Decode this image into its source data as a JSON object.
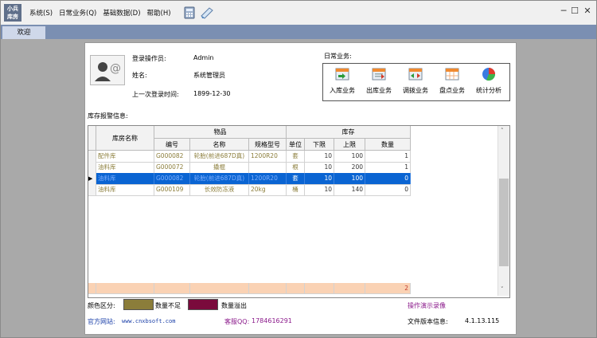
{
  "app": {
    "logo_text": "小兵\n库房",
    "logo_line1": "小兵",
    "logo_line2": "库房"
  },
  "menu": [
    {
      "label": "系统(S)"
    },
    {
      "label": "日常业务(Q)"
    },
    {
      "label": "基础数据(D)"
    },
    {
      "label": "帮助(H)"
    }
  ],
  "tabs": [
    {
      "label": "欢迎"
    }
  ],
  "login": {
    "operator_label": "登录操作员:",
    "operator_value": "Admin",
    "name_label": "姓名:",
    "name_value": "系统管理员",
    "last_login_label": "上一次登录时间:",
    "last_login_value": "1899-12-30"
  },
  "business": {
    "title": "日常业务:",
    "buttons": [
      {
        "label": "入库业务",
        "icon": "inbound-icon"
      },
      {
        "label": "出库业务",
        "icon": "outbound-icon"
      },
      {
        "label": "调拨业务",
        "icon": "transfer-icon"
      },
      {
        "label": "盘点业务",
        "icon": "inventory-check-icon"
      },
      {
        "label": "统计分析",
        "icon": "pie-chart-icon"
      }
    ]
  },
  "stock_alert": {
    "title": "库存报警信息:",
    "headers": {
      "warehouse": "库房名称",
      "goods": "物品",
      "stock": "库存",
      "code": "编号",
      "name": "名称",
      "spec": "规格型号",
      "unit": "单位",
      "lower": "下限",
      "upper": "上限",
      "qty": "数量"
    },
    "rows": [
      {
        "warehouse": "配件库",
        "code": "G000082",
        "name": "轮胎(前进687D真)",
        "spec": "1200R20",
        "unit": "套",
        "lower": "10",
        "upper": "100",
        "qty": "1",
        "status": "insufficient"
      },
      {
        "warehouse": "油料库",
        "code": "G000072",
        "name": "撬棍",
        "spec": "",
        "unit": "根",
        "lower": "10",
        "upper": "200",
        "qty": "1",
        "status": "insufficient"
      },
      {
        "warehouse": "油料库",
        "code": "G000082",
        "name": "轮胎(前进687D真)",
        "spec": "1200R20",
        "unit": "套",
        "lower": "10",
        "upper": "100",
        "qty": "0",
        "status": "selected"
      },
      {
        "warehouse": "油料库",
        "code": "G000109",
        "name": "长效防冻液",
        "spec": "20kg",
        "unit": "桶",
        "lower": "10",
        "upper": "140",
        "qty": "0",
        "status": "insufficient"
      }
    ],
    "total_qty": "2"
  },
  "legend": {
    "label": "颜色区分:",
    "insufficient_label": "数量不足",
    "overflow_label": "数量溢出",
    "insufficient_color": "#8b7d3a",
    "overflow_color": "#7a0a3c"
  },
  "links": {
    "demo_video": "操作演示录像",
    "website_label": "官方网站:",
    "website_value": "www.cnxbsoft.com",
    "qq_label": "客服QQ:",
    "qq_value": "1784616291",
    "version_label": "文件版本信息:",
    "version_value": "4.1.13.115"
  },
  "colors": {
    "tabbar": "#7b8fb2",
    "selected_row": "#0a64d2",
    "total_row": "#fad2b4",
    "insufficient_text": "#8b7d3a"
  }
}
